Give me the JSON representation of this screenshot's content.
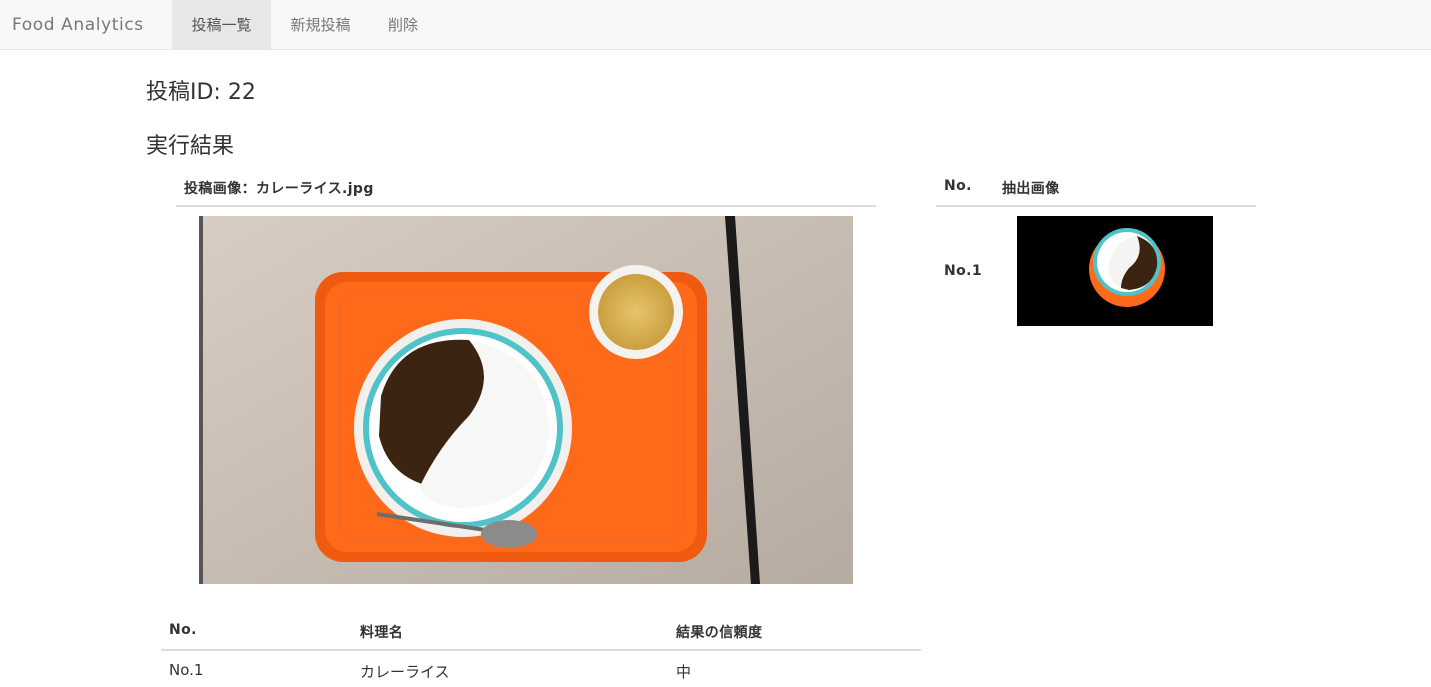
{
  "navbar": {
    "brand": "Food Analytics",
    "items": [
      {
        "label": "投稿一覧",
        "active": true
      },
      {
        "label": "新規投稿",
        "active": false
      },
      {
        "label": "削除",
        "active": false
      }
    ]
  },
  "post": {
    "heading": "投稿ID: 22",
    "section_title": "実行結果",
    "image_caption": "投稿画像：カレーライス.jpg"
  },
  "extract_table": {
    "headers": [
      "No.",
      "抽出画像"
    ],
    "rows": [
      {
        "no": "No.1"
      }
    ]
  },
  "result_table": {
    "headers": [
      "No.",
      "料理名",
      "結果の信頼度"
    ],
    "rows": [
      {
        "no": "No.1",
        "dish": "カレーライス",
        "confidence": "中"
      }
    ]
  },
  "colors": {
    "tray": "#ff6a1a",
    "table_surface": "#cfc4b8",
    "curry": "#3b2412",
    "plate_rim": "#4fc3c8"
  }
}
